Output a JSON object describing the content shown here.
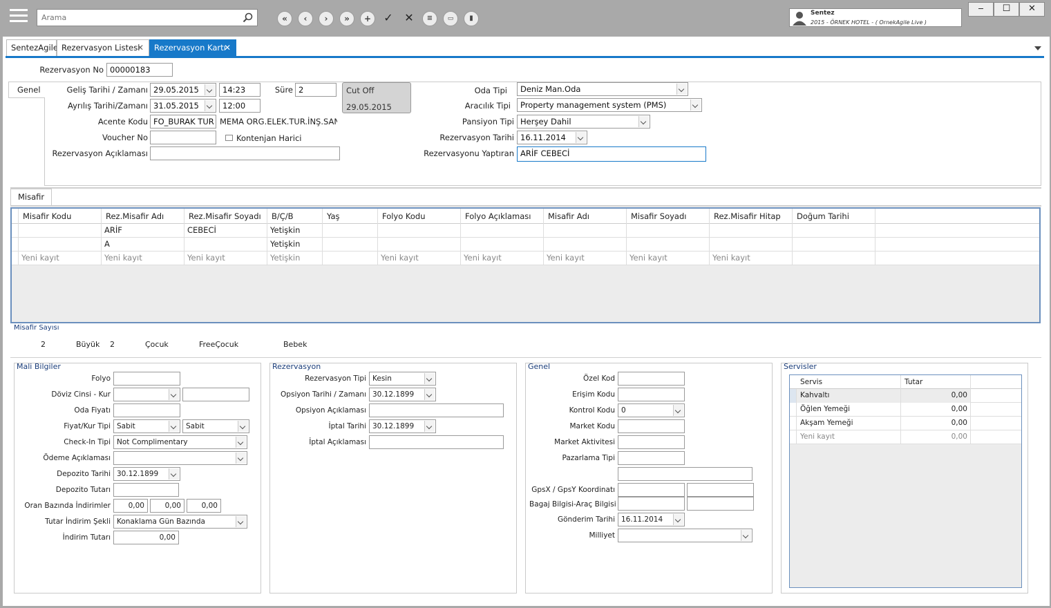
{
  "toolbar": {
    "search_placeholder": "Arama",
    "buttons": [
      "first",
      "prev",
      "next",
      "last",
      "add",
      "save",
      "cancel",
      "list",
      "print",
      "delete"
    ]
  },
  "user": {
    "name": "Sentez",
    "hotel": "2015 - ÖRNEK HOTEL - ( OrnekAgile Live )"
  },
  "window": {
    "minimize": "‒",
    "maximize": "☐",
    "close": "✕"
  },
  "tabs": [
    {
      "label": "SentezAgile"
    },
    {
      "label": "Rezervasyon Listesi",
      "close": "✕"
    },
    {
      "label": "Rezervasyon Kartı",
      "close": "✕"
    }
  ],
  "header": {
    "rez_no_label": "Rezervasyon No",
    "rez_no": "00000183"
  },
  "general": {
    "tab": "Genel",
    "arrival_label": "Geliş Tarihi / Zamanı",
    "arrival_date": "29.05.2015",
    "arrival_time": "14:23",
    "departure_label": "Ayrılış Tarihi/Zamanı",
    "departure_date": "31.05.2015",
    "departure_time": "12:00",
    "duration_label": "Süre",
    "duration": "2",
    "cutoff_label": "Cut Off",
    "cutoff_date": "29.05.2015",
    "agency_label": "Acente Kodu",
    "agency_code": "FO_BURAK TUR",
    "agency_name": "MEMA ORG.ELEK.TUR.İNŞ.SAN.T",
    "voucher_label": "Voucher No",
    "voucher": "",
    "quota_label": "Kontenjan Harici",
    "desc_label": "Rezervasyon Açıklaması",
    "desc": "",
    "room_type_label": "Oda Tipi",
    "room_type": "Deniz Man.Oda",
    "broker_label": "Aracılık Tipi",
    "broker": "Property management system (PMS)",
    "board_label": "Pansiyon Tipi",
    "board": "Herşey Dahil",
    "rez_date_label": "Rezervasyon Tarihi",
    "rez_date": "16.11.2014",
    "made_by_label": "Rezervasyonu Yaptıran",
    "made_by": "ARİF CEBECİ"
  },
  "guests": {
    "tab": "Misafir",
    "columns": [
      "Misafir Kodu",
      "Rez.Misafir Adı",
      "Rez.Misafir Soyadı",
      "B/Ç/B",
      "Yaş",
      "Folyo Kodu",
      "Folyo Açıklaması",
      "Misafir Adı",
      "Misafir Soyadı",
      "Rez.Misafir Hitap",
      "Doğum Tarihi"
    ],
    "rows": [
      [
        "",
        "ARİF",
        "CEBECİ",
        "Yetişkin",
        "",
        "",
        "",
        "",
        "",
        "",
        ""
      ],
      [
        "",
        "A",
        "",
        "Yetişkin",
        "",
        "",
        "",
        "",
        "",
        "",
        ""
      ],
      [
        "Yeni kayıt",
        "Yeni kayıt",
        "Yeni kayıt",
        "Yetişkin",
        "",
        "Yeni kayıt",
        "Yeni kayıt",
        "Yeni kayıt",
        "Yeni kayıt",
        "Yeni kayıt",
        ""
      ]
    ]
  },
  "guest_count": {
    "title": "Misafir Sayısı",
    "adult": "2",
    "adult_label": "Büyük",
    "child": "2",
    "child_label": "Çocuk",
    "free_child_label": "FreeÇocuk",
    "baby_label": "Bebek"
  },
  "finance": {
    "title": "Mali Bilgiler",
    "folio_label": "Folyo",
    "folio": "",
    "currency_label": "Döviz Cinsi - Kur",
    "currency": "",
    "rate": "",
    "room_price_label": "Oda Fiyatı",
    "room_price": "",
    "price_type_label": "Fiyat/Kur Tipi",
    "price_type": "Sabit",
    "rate_type": "Sabit",
    "checkin_type_label": "Check-In Tipi",
    "checkin_type": "Not Complimentary",
    "payment_desc_label": "Ödeme Açıklaması",
    "payment_desc": "",
    "deposit_date_label": "Depozito Tarihi",
    "deposit_date": "30.12.1899",
    "deposit_amount_label": "Depozito Tutarı",
    "deposit_amount": "",
    "discount_rate_label": "Oran Bazında İndirimler",
    "discount_1": "0,00",
    "discount_2": "0,00",
    "discount_3": "0,00",
    "discount_type_label": "Tutar İndirim Şekli",
    "discount_type": "Konaklama Gün Bazında",
    "discount_amount_label": "İndirim Tutarı",
    "discount_amount": "0,00"
  },
  "reservation": {
    "title": "Rezervasyon",
    "type_label": "Rezervasyon Tipi",
    "type": "Kesin",
    "option_label": "Opsiyon Tarihi /  Zamanı",
    "option_date": "30.12.1899",
    "option_desc_label": "Opsiyon Açıklaması",
    "option_desc": "",
    "cancel_date_label": "İptal Tarihi",
    "cancel_date": "30.12.1899",
    "cancel_desc_label": "İptal Açıklaması",
    "cancel_desc": ""
  },
  "general2": {
    "title": "Genel",
    "special_code_label": "Özel Kod",
    "special_code": "",
    "access_code_label": "Erişim Kodu",
    "access_code": "",
    "control_code_label": "Kontrol Kodu",
    "control_code": "0",
    "market_code_label": "Market Kodu",
    "market_code": "",
    "market_activity_label": "Market Aktivitesi",
    "market_activity": "",
    "marketing_type_label": "Pazarlama Tipi",
    "marketing_type": "",
    "gps_label": "GpsX / GpsY Koordinatı",
    "baggage_label": "Bagaj Bilgisi-Araç Bilgisi",
    "send_date_label": "Gönderim Tarihi",
    "send_date": "16.11.2014",
    "nationality_label": "Milliyet",
    "nationality": ""
  },
  "services": {
    "title": "Servisler",
    "columns": [
      "Servis",
      "Tutar"
    ],
    "rows": [
      [
        "Kahvaltı",
        "0,00"
      ],
      [
        "Öğlen Yemeği",
        "0,00"
      ],
      [
        "Akşam Yemeği",
        "0,00"
      ],
      [
        "Yeni kayıt",
        "0,00"
      ]
    ]
  }
}
